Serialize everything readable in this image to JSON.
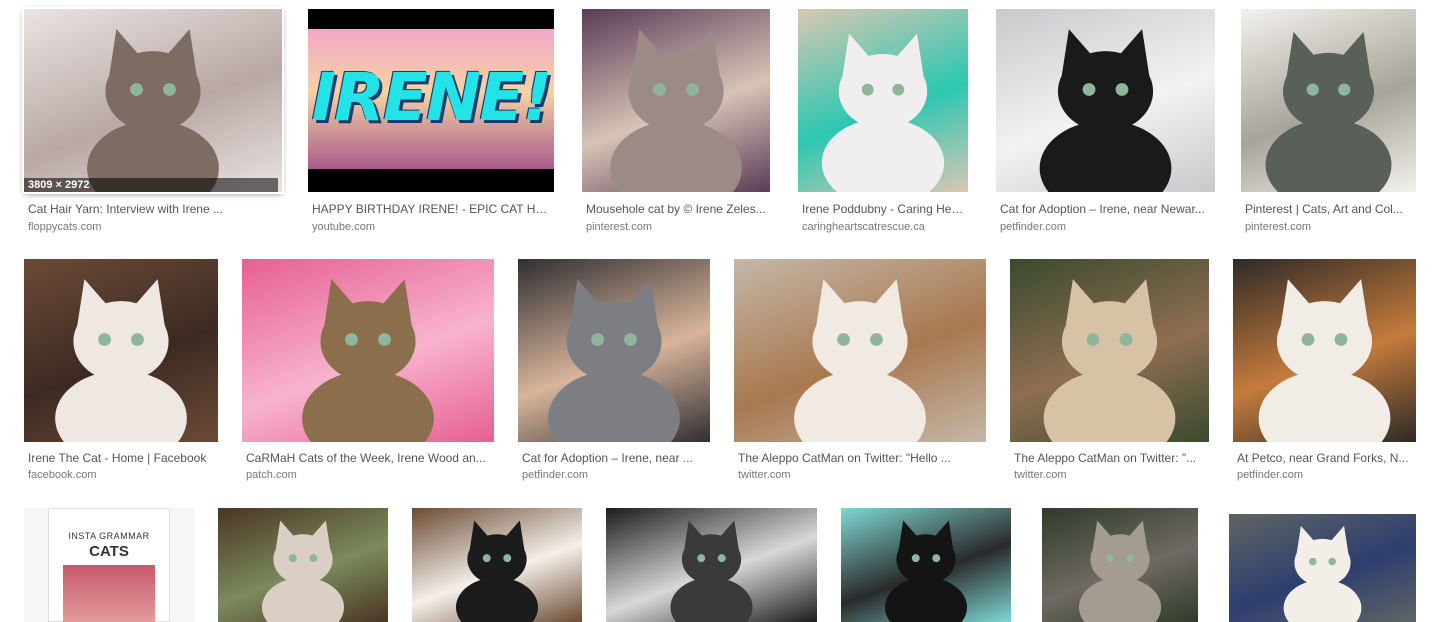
{
  "results": [
    {
      "title": "Cat Hair Yarn: Interview with Irene ...",
      "domain": "floppycats.com",
      "dims": "3809 × 2972",
      "colors": [
        "#e9e4e2",
        "#7d6b64",
        "#b9a8a4"
      ]
    },
    {
      "title": "HAPPY BIRTHDAY IRENE! - EPIC CAT Hap...",
      "domain": "youtube.com",
      "banner": "IRENE!"
    },
    {
      "title": "Mousehole cat by © Irene Zeles...",
      "domain": "pinterest.com",
      "colors": [
        "#5b3b58",
        "#9b8a86",
        "#d7c3b6"
      ]
    },
    {
      "title": "Irene Poddubny - Caring Hea...",
      "domain": "caringheartscatrescue.ca",
      "colors": [
        "#d8c7b2",
        "#f0eeee",
        "#2dc7b1"
      ]
    },
    {
      "title": "Cat for Adoption – Irene, near Newar...",
      "domain": "petfinder.com",
      "colors": [
        "#c9c9cb",
        "#1a1a1a",
        "#f2f2f2"
      ]
    },
    {
      "title": "Pinterest | Cats, Art and Col...",
      "domain": "pinterest.com",
      "colors": [
        "#f3f1ec",
        "#59605a",
        "#a7a49a"
      ]
    },
    {
      "title": "Irene The Cat - Home | Facebook",
      "domain": "facebook.com",
      "colors": [
        "#6b4a36",
        "#efe8e2",
        "#3c2a22"
      ]
    },
    {
      "title": "CaRMaH Cats of the Week, Irene Wood an...",
      "domain": "patch.com",
      "colors": [
        "#e65f93",
        "#8b6e4b",
        "#f8b3cd"
      ]
    },
    {
      "title": "Cat for Adoption – Irene, near ...",
      "domain": "petfinder.com",
      "colors": [
        "#2f2f33",
        "#7c7e84",
        "#d8b49a"
      ]
    },
    {
      "title": "The Aleppo CatMan on Twitter: \"Hello ...",
      "domain": "twitter.com",
      "colors": [
        "#c4b7a8",
        "#f0eae2",
        "#a9784f"
      ]
    },
    {
      "title": "The Aleppo CatMan on Twitter: \"...",
      "domain": "twitter.com",
      "colors": [
        "#3a4a2e",
        "#d8c2a6",
        "#8e6e52"
      ]
    },
    {
      "title": "At Petco, near Grand Forks, N...",
      "domain": "petfinder.com",
      "colors": [
        "#2e2a27",
        "#f1ece6",
        "#c57b3c"
      ]
    },
    {
      "title": "",
      "domain": "",
      "card_sub": "INSTA GRAMMAR",
      "card_main": "CATS"
    },
    {
      "title": "",
      "domain": "",
      "colors": [
        "#4a3525",
        "#d9cfc4",
        "#7b8b5c"
      ]
    },
    {
      "title": "",
      "domain": "",
      "colors": [
        "#6b4b33",
        "#1b1b1b",
        "#f4f0ea"
      ]
    },
    {
      "title": "",
      "domain": "",
      "colors": [
        "#1c1c1c",
        "#3a3a3a",
        "#d8d8d8"
      ]
    },
    {
      "title": "",
      "domain": "",
      "colors": [
        "#7fd8d4",
        "#141414",
        "#2a2a2a"
      ]
    },
    {
      "title": "",
      "domain": "",
      "colors": [
        "#2e3b2a",
        "#a59c91",
        "#6f6a63"
      ]
    },
    {
      "title": "",
      "domain": "",
      "colors": [
        "#5f6464",
        "#f3efe8",
        "#2d3e6f"
      ]
    }
  ]
}
